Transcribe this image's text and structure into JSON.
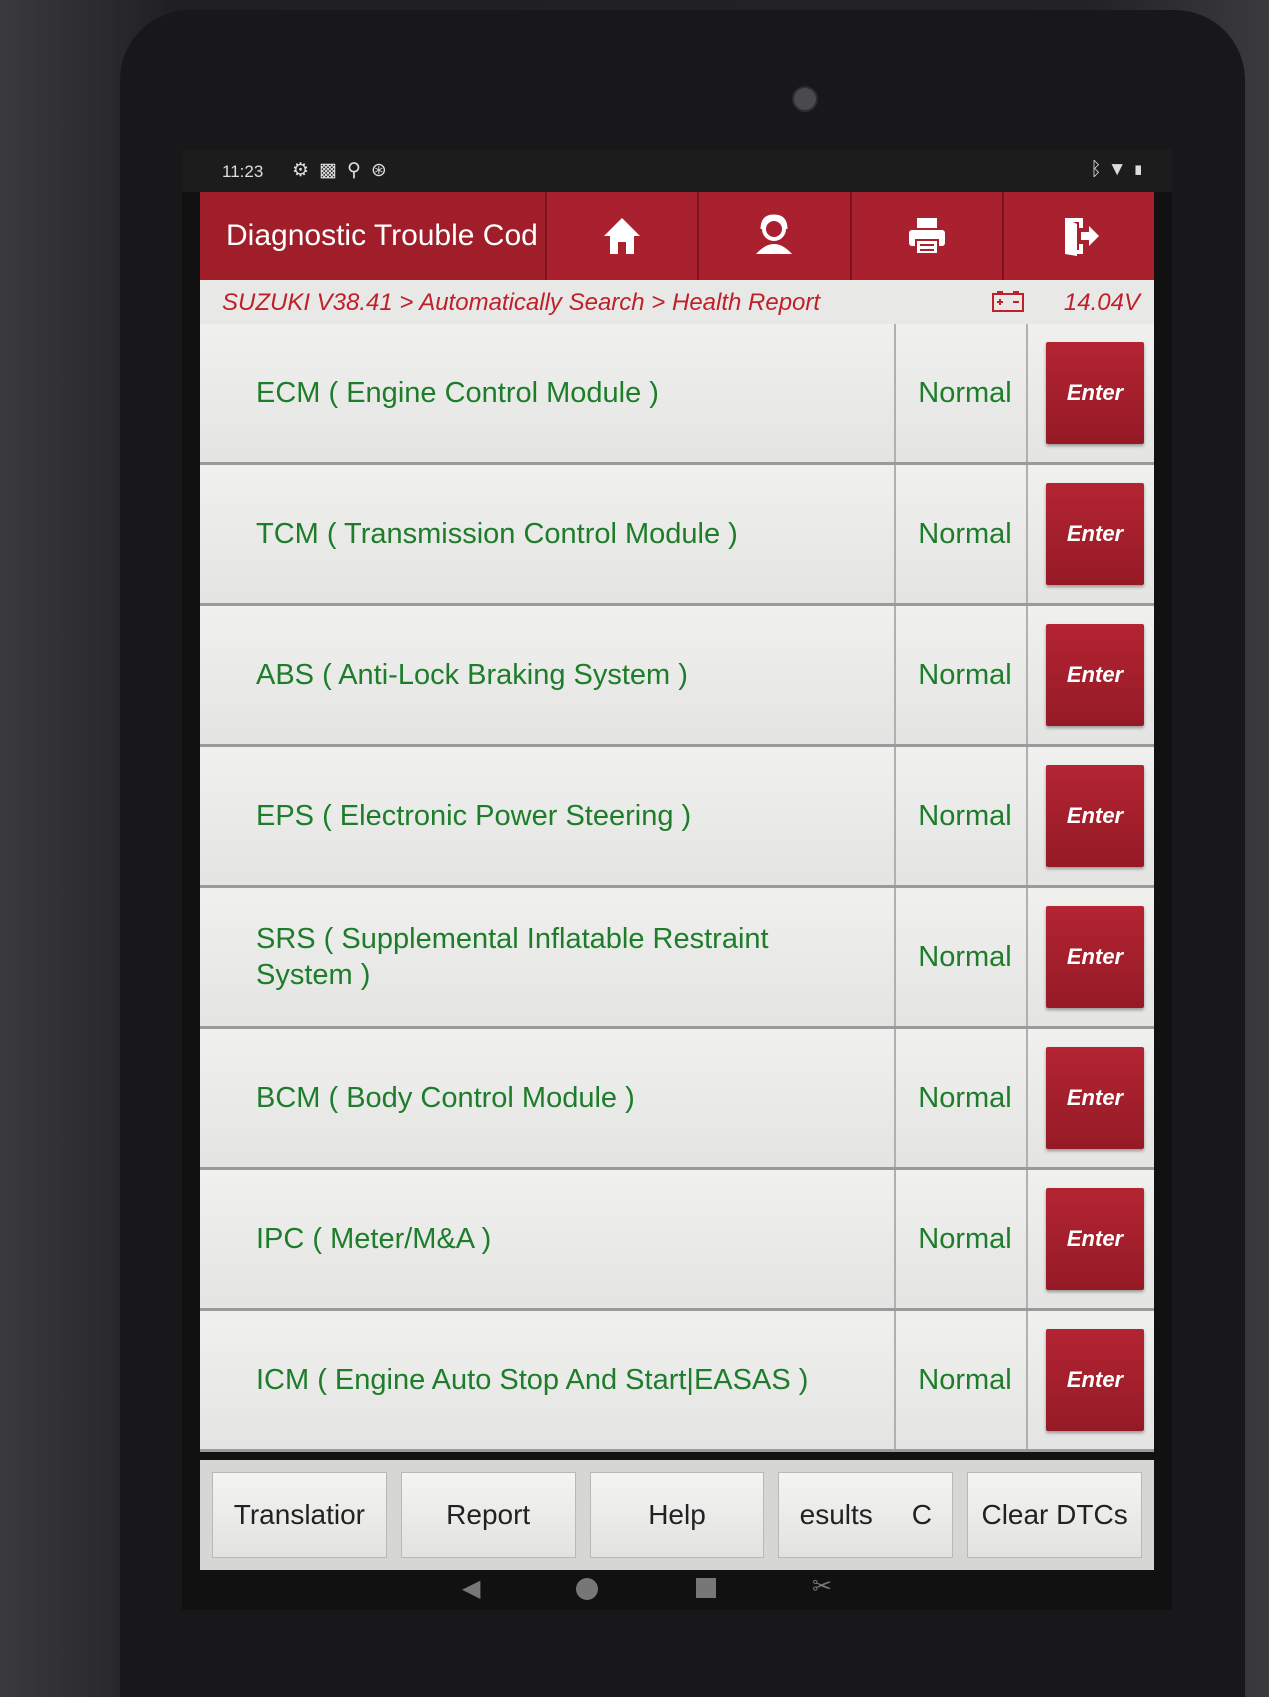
{
  "status_bar": {
    "time": "11:23",
    "left_icons": [
      "gear-icon",
      "image-icon",
      "usb-icon",
      "target-icon"
    ],
    "right_icons": [
      "bluetooth-icon",
      "wifi-icon",
      "battery-icon"
    ]
  },
  "app_bar": {
    "title": "Diagnostic Trouble Cod",
    "actions": [
      "home-icon",
      "user-icon",
      "printer-icon",
      "exit-icon"
    ],
    "color": "#a01d2a"
  },
  "breadcrumb": {
    "path": "SUZUKI V38.41 > Automatically Search > Health Report",
    "voltage": "14.04V"
  },
  "modules": [
    {
      "name": "ECM ( Engine Control Module )",
      "status": "Normal",
      "action": "Enter"
    },
    {
      "name": "TCM ( Transmission Control Module )",
      "status": "Normal",
      "action": "Enter"
    },
    {
      "name": "ABS ( Anti-Lock Braking System )",
      "status": "Normal",
      "action": "Enter"
    },
    {
      "name": "EPS ( Electronic Power Steering )",
      "status": "Normal",
      "action": "Enter"
    },
    {
      "name": "SRS ( Supplemental Inflatable Restraint System )",
      "status": "Normal",
      "action": "Enter"
    },
    {
      "name": "BCM ( Body Control Module )",
      "status": "Normal",
      "action": "Enter"
    },
    {
      "name": "IPC ( Meter/M&A )",
      "status": "Normal",
      "action": "Enter"
    },
    {
      "name": "ICM ( Engine Auto Stop And Start|EASAS )",
      "status": "Normal",
      "action": "Enter"
    }
  ],
  "bottom_buttons": [
    {
      "label": "Translatior"
    },
    {
      "label": "Report"
    },
    {
      "label": "Help"
    },
    {
      "label": "esults     C"
    },
    {
      "label": "Clear DTCs"
    }
  ],
  "colors": {
    "accent": "#a01d2a",
    "text_green": "#1d7d2a",
    "breadcrumb_red": "#c0202a"
  }
}
